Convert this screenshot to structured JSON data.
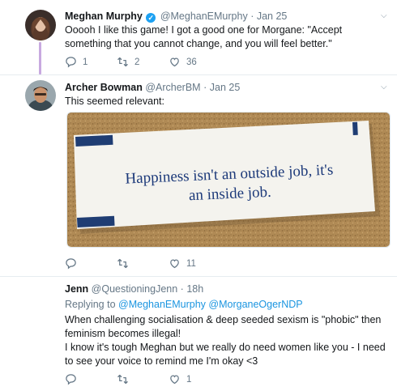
{
  "tweets": [
    {
      "name": "Meghan Murphy",
      "handle": "@MeghanEMurphy",
      "dot": "·",
      "date": "Jan 25",
      "text": "Ooooh I like this game! I got a good one for Morgane: \"Accept something that you cannot change, and you will feel better.\"",
      "actions": {
        "replies": "1",
        "retweets": "2",
        "likes": "36"
      }
    },
    {
      "name": "Archer Bowman",
      "handle": "@ArcherBM",
      "dot": "·",
      "date": "Jan 25",
      "text": "This seemed relevant:",
      "image": {
        "line1": "Happiness isn't an outside job, it's",
        "line2": "an inside job."
      },
      "actions": {
        "replies": "",
        "retweets": "",
        "likes": "11"
      }
    },
    {
      "name": "Jenn",
      "handle": "@QuestioningJenn",
      "dot": "·",
      "date": "18h",
      "replying_prefix": "Replying to",
      "replying_to": [
        "@MeghanEMurphy",
        "@MorganeOgerNDP"
      ],
      "paragraphs": [
        "When challenging socialisation & deep seeded sexism is \"phobic\" then feminism becomes illegal!",
        "I know it's tough Meghan but we really do need women like you - I need to see your voice to remind me I'm okay <3"
      ],
      "actions": {
        "replies": "",
        "retweets": "",
        "likes": "1"
      }
    }
  ],
  "icons": {
    "reply": "reply-icon",
    "retweet": "retweet-icon",
    "like": "heart-icon",
    "caret": "chevron-down-icon",
    "verified": "verified-badge-icon"
  },
  "colors": {
    "thread_line": "#c8a9e0",
    "link": "#1b95e0",
    "verified": "#1da1f2",
    "secondary_text": "#657786"
  }
}
